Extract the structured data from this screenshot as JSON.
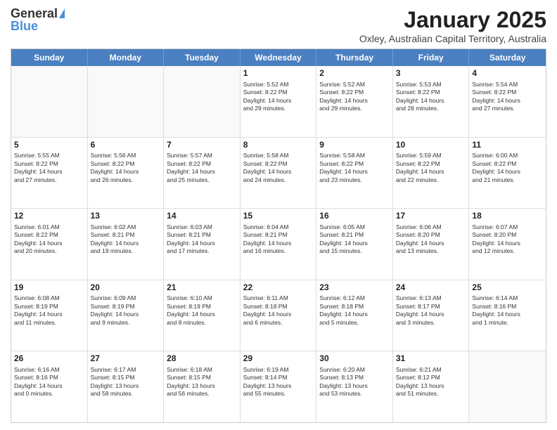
{
  "logo": {
    "general": "General",
    "blue": "Blue"
  },
  "title": "January 2025",
  "subtitle": "Oxley, Australian Capital Territory, Australia",
  "day_headers": [
    "Sunday",
    "Monday",
    "Tuesday",
    "Wednesday",
    "Thursday",
    "Friday",
    "Saturday"
  ],
  "rows": [
    [
      {
        "day": "",
        "info": ""
      },
      {
        "day": "",
        "info": ""
      },
      {
        "day": "",
        "info": ""
      },
      {
        "day": "1",
        "info": "Sunrise: 5:52 AM\nSunset: 8:22 PM\nDaylight: 14 hours\nand 29 minutes."
      },
      {
        "day": "2",
        "info": "Sunrise: 5:52 AM\nSunset: 8:22 PM\nDaylight: 14 hours\nand 29 minutes."
      },
      {
        "day": "3",
        "info": "Sunrise: 5:53 AM\nSunset: 8:22 PM\nDaylight: 14 hours\nand 28 minutes."
      },
      {
        "day": "4",
        "info": "Sunrise: 5:54 AM\nSunset: 8:22 PM\nDaylight: 14 hours\nand 27 minutes."
      }
    ],
    [
      {
        "day": "5",
        "info": "Sunrise: 5:55 AM\nSunset: 8:22 PM\nDaylight: 14 hours\nand 27 minutes."
      },
      {
        "day": "6",
        "info": "Sunrise: 5:56 AM\nSunset: 8:22 PM\nDaylight: 14 hours\nand 26 minutes."
      },
      {
        "day": "7",
        "info": "Sunrise: 5:57 AM\nSunset: 8:22 PM\nDaylight: 14 hours\nand 25 minutes."
      },
      {
        "day": "8",
        "info": "Sunrise: 5:58 AM\nSunset: 8:22 PM\nDaylight: 14 hours\nand 24 minutes."
      },
      {
        "day": "9",
        "info": "Sunrise: 5:58 AM\nSunset: 8:22 PM\nDaylight: 14 hours\nand 23 minutes."
      },
      {
        "day": "10",
        "info": "Sunrise: 5:59 AM\nSunset: 8:22 PM\nDaylight: 14 hours\nand 22 minutes."
      },
      {
        "day": "11",
        "info": "Sunrise: 6:00 AM\nSunset: 8:22 PM\nDaylight: 14 hours\nand 21 minutes."
      }
    ],
    [
      {
        "day": "12",
        "info": "Sunrise: 6:01 AM\nSunset: 8:22 PM\nDaylight: 14 hours\nand 20 minutes."
      },
      {
        "day": "13",
        "info": "Sunrise: 6:02 AM\nSunset: 8:21 PM\nDaylight: 14 hours\nand 19 minutes."
      },
      {
        "day": "14",
        "info": "Sunrise: 6:03 AM\nSunset: 8:21 PM\nDaylight: 14 hours\nand 17 minutes."
      },
      {
        "day": "15",
        "info": "Sunrise: 6:04 AM\nSunset: 8:21 PM\nDaylight: 14 hours\nand 16 minutes."
      },
      {
        "day": "16",
        "info": "Sunrise: 6:05 AM\nSunset: 8:21 PM\nDaylight: 14 hours\nand 15 minutes."
      },
      {
        "day": "17",
        "info": "Sunrise: 6:06 AM\nSunset: 8:20 PM\nDaylight: 14 hours\nand 13 minutes."
      },
      {
        "day": "18",
        "info": "Sunrise: 6:07 AM\nSunset: 8:20 PM\nDaylight: 14 hours\nand 12 minutes."
      }
    ],
    [
      {
        "day": "19",
        "info": "Sunrise: 6:08 AM\nSunset: 8:19 PM\nDaylight: 14 hours\nand 11 minutes."
      },
      {
        "day": "20",
        "info": "Sunrise: 6:09 AM\nSunset: 8:19 PM\nDaylight: 14 hours\nand 9 minutes."
      },
      {
        "day": "21",
        "info": "Sunrise: 6:10 AM\nSunset: 8:19 PM\nDaylight: 14 hours\nand 8 minutes."
      },
      {
        "day": "22",
        "info": "Sunrise: 6:11 AM\nSunset: 8:18 PM\nDaylight: 14 hours\nand 6 minutes."
      },
      {
        "day": "23",
        "info": "Sunrise: 6:12 AM\nSunset: 8:18 PM\nDaylight: 14 hours\nand 5 minutes."
      },
      {
        "day": "24",
        "info": "Sunrise: 6:13 AM\nSunset: 8:17 PM\nDaylight: 14 hours\nand 3 minutes."
      },
      {
        "day": "25",
        "info": "Sunrise: 6:14 AM\nSunset: 8:16 PM\nDaylight: 14 hours\nand 1 minute."
      }
    ],
    [
      {
        "day": "26",
        "info": "Sunrise: 6:16 AM\nSunset: 8:16 PM\nDaylight: 14 hours\nand 0 minutes."
      },
      {
        "day": "27",
        "info": "Sunrise: 6:17 AM\nSunset: 8:15 PM\nDaylight: 13 hours\nand 58 minutes."
      },
      {
        "day": "28",
        "info": "Sunrise: 6:18 AM\nSunset: 8:15 PM\nDaylight: 13 hours\nand 56 minutes."
      },
      {
        "day": "29",
        "info": "Sunrise: 6:19 AM\nSunset: 8:14 PM\nDaylight: 13 hours\nand 55 minutes."
      },
      {
        "day": "30",
        "info": "Sunrise: 6:20 AM\nSunset: 8:13 PM\nDaylight: 13 hours\nand 53 minutes."
      },
      {
        "day": "31",
        "info": "Sunrise: 6:21 AM\nSunset: 8:12 PM\nDaylight: 13 hours\nand 51 minutes."
      },
      {
        "day": "",
        "info": ""
      }
    ]
  ]
}
